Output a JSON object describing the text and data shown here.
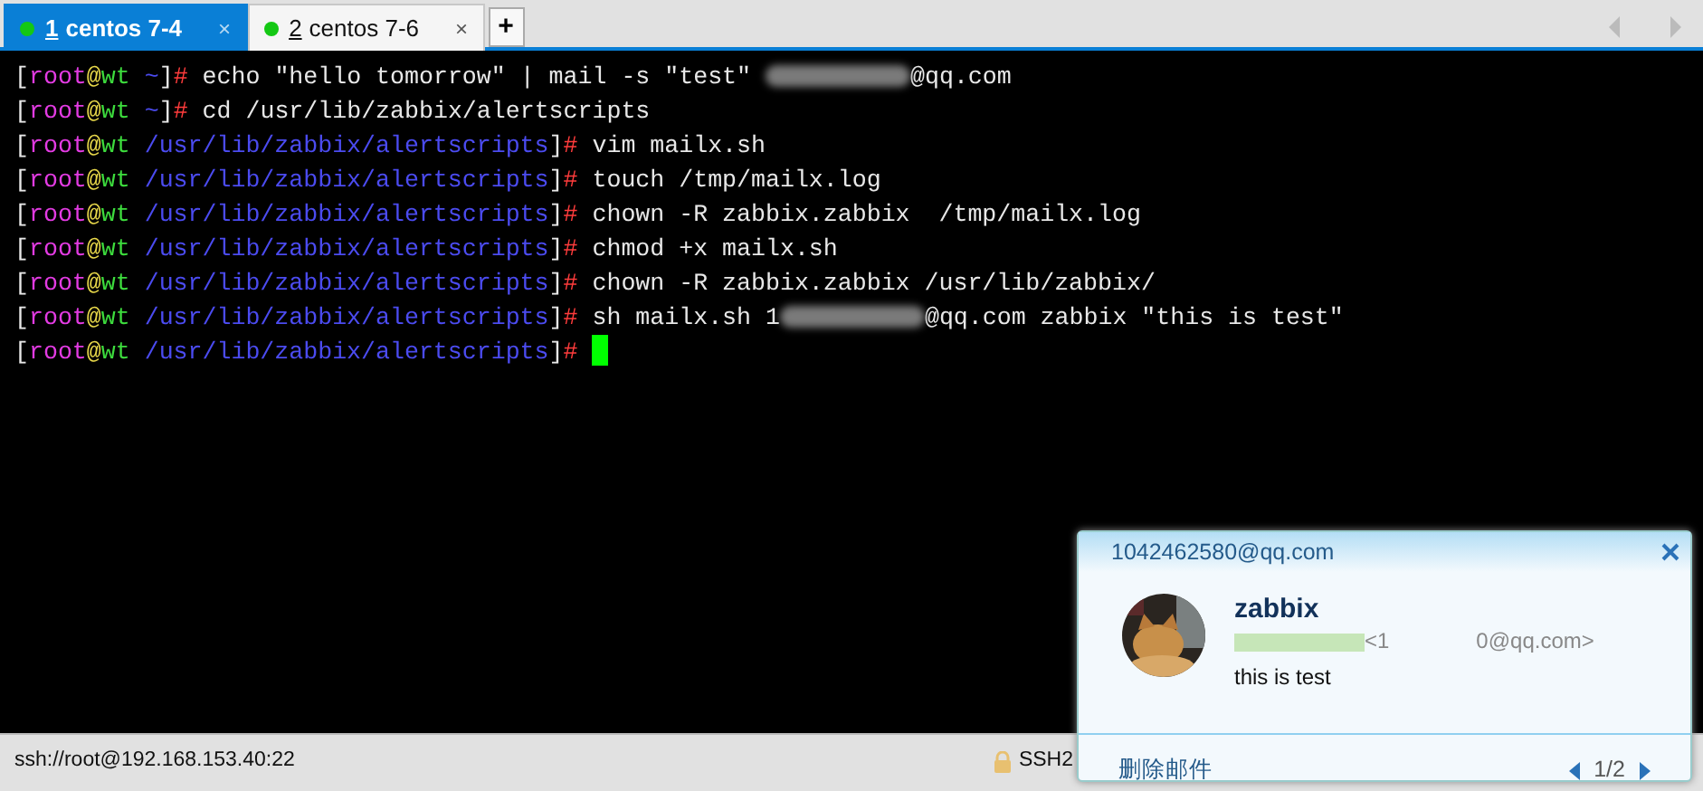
{
  "tabs": [
    {
      "number": "1",
      "label": "centos  7-4",
      "selected": true,
      "connected": true,
      "close": "×"
    },
    {
      "number": "2",
      "label": "centos  7-6",
      "selected": false,
      "connected": true,
      "close": "×"
    }
  ],
  "new_tab": "+",
  "terminal": {
    "lines": [
      {
        "user": "root",
        "host": "wt",
        "path": "~",
        "command": "echo \"hello tomorrow\" | mail -s \"test\" ",
        "redacted": true,
        "command_tail": "@qq.com"
      },
      {
        "user": "root",
        "host": "wt",
        "path": "~",
        "command": "cd /usr/lib/zabbix/alertscripts"
      },
      {
        "user": "root",
        "host": "wt",
        "path": "/usr/lib/zabbix/alertscripts",
        "command": "vim mailx.sh"
      },
      {
        "user": "root",
        "host": "wt",
        "path": "/usr/lib/zabbix/alertscripts",
        "command": "touch /tmp/mailx.log"
      },
      {
        "user": "root",
        "host": "wt",
        "path": "/usr/lib/zabbix/alertscripts",
        "command": "chown -R zabbix.zabbix  /tmp/mailx.log"
      },
      {
        "user": "root",
        "host": "wt",
        "path": "/usr/lib/zabbix/alertscripts",
        "command": "chmod +x mailx.sh"
      },
      {
        "user": "root",
        "host": "wt",
        "path": "/usr/lib/zabbix/alertscripts",
        "command": "chown -R zabbix.zabbix /usr/lib/zabbix/"
      },
      {
        "user": "root",
        "host": "wt",
        "path": "/usr/lib/zabbix/alertscripts",
        "command": "sh mailx.sh 1",
        "redacted": true,
        "command_tail": "@qq.com zabbix \"this is test\""
      },
      {
        "user": "root",
        "host": "wt",
        "path": "/usr/lib/zabbix/alertscripts",
        "cursor": true
      }
    ]
  },
  "prompt_marks": {
    "open": "[",
    "at": "@",
    "close": "]",
    "sign": "#"
  },
  "status_bar": {
    "connection": "ssh://root@192.168.153.40:22",
    "protocol": "SSH2"
  },
  "notification": {
    "account": "1042462580@qq.com",
    "sender": "zabbix",
    "address_redacted": true,
    "address": "<1",
    "address_tail": "0@qq.com>",
    "message": "this is test",
    "delete": "删除邮件",
    "page": "1/2"
  }
}
